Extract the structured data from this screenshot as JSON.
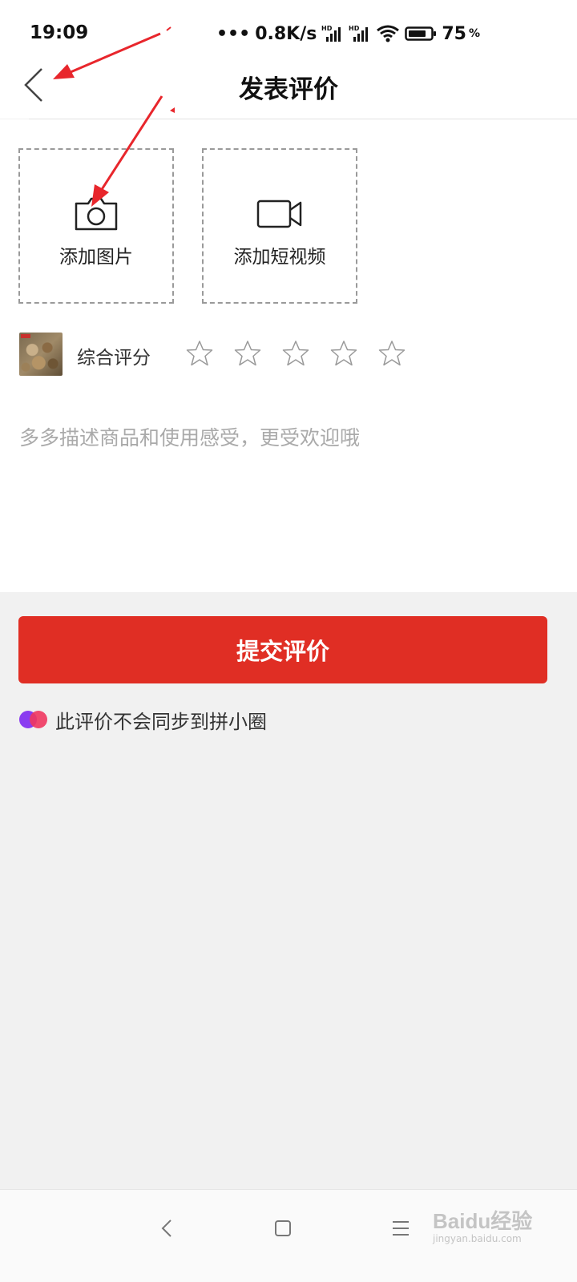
{
  "status_bar": {
    "time": "19:09",
    "network_speed": "0.8K/s",
    "battery_level": "75",
    "battery_unit": "%"
  },
  "header": {
    "title": "发表评价"
  },
  "upload": {
    "photo_label": "添加图片",
    "video_label": "添加短视频"
  },
  "rating": {
    "label": "综合评分",
    "max_stars": 5,
    "selected_stars": 0
  },
  "review": {
    "placeholder": "多多描述商品和使用感受，更受欢迎哦",
    "value": ""
  },
  "submit_label": "提交评价",
  "notice_text": "此评价不会同步到拼小圈",
  "watermark": {
    "brand": "Baidu经验",
    "url": "jingyan.baidu.com"
  },
  "colors": {
    "accent": "#e02e24",
    "arrow": "#e8262c",
    "page_bg": "#f1f1f1",
    "star_outline": "#999999"
  }
}
